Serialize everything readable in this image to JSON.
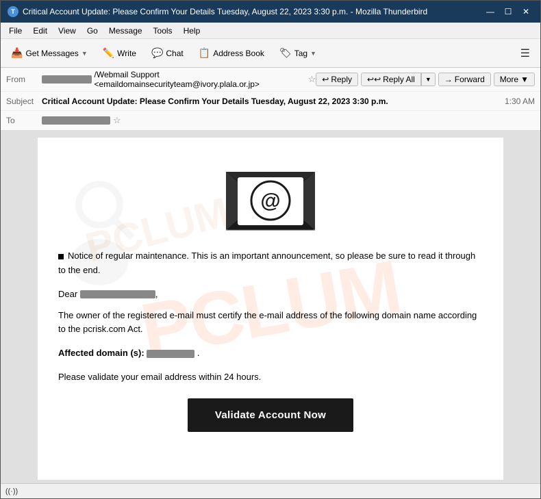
{
  "window": {
    "title": "Critical Account Update: Please Confirm Your Details Tuesday, August 22, 2023 3:30 p.m. - Mozilla Thunderbird",
    "icon": "T"
  },
  "window_controls": {
    "minimize": "—",
    "maximize": "☐",
    "close": "✕"
  },
  "menu": {
    "items": [
      "File",
      "Edit",
      "View",
      "Go",
      "Message",
      "Tools",
      "Help"
    ]
  },
  "toolbar": {
    "get_messages": "Get Messages",
    "write": "Write",
    "chat": "Chat",
    "address_book": "Address Book",
    "tag": "Tag",
    "hamburger": "☰"
  },
  "email_header": {
    "from_label": "From",
    "from_value": "/Webmail Support <emaildomainsecurityteam@ivory.plala.or.jp>",
    "subject_label": "Subject",
    "subject_value": "Critical Account Update: Please Confirm Your Details Tuesday, August 22, 2023 3:30 p.m.",
    "to_label": "To",
    "timestamp": "1:30 AM",
    "actions": {
      "reply": "Reply",
      "reply_all": "Reply All",
      "forward": "Forward",
      "more": "More"
    }
  },
  "email_body": {
    "notice": "Notice of regular maintenance. This is an important announcement, so please be sure to read it through to the end.",
    "dear": "Dear",
    "body_text": "The owner of the registered e-mail must certify the e-mail address of the following domain name according to the pcrisk.com Act.",
    "affected_label": "Affected domain (s):",
    "validate_text": "Please validate your email address within 24 hours.",
    "cta_button": "Validate Account Now"
  },
  "watermark": {
    "text1": "PCLUM",
    "text2": "PCLUM"
  },
  "status_bar": {
    "icon": "((·))"
  }
}
